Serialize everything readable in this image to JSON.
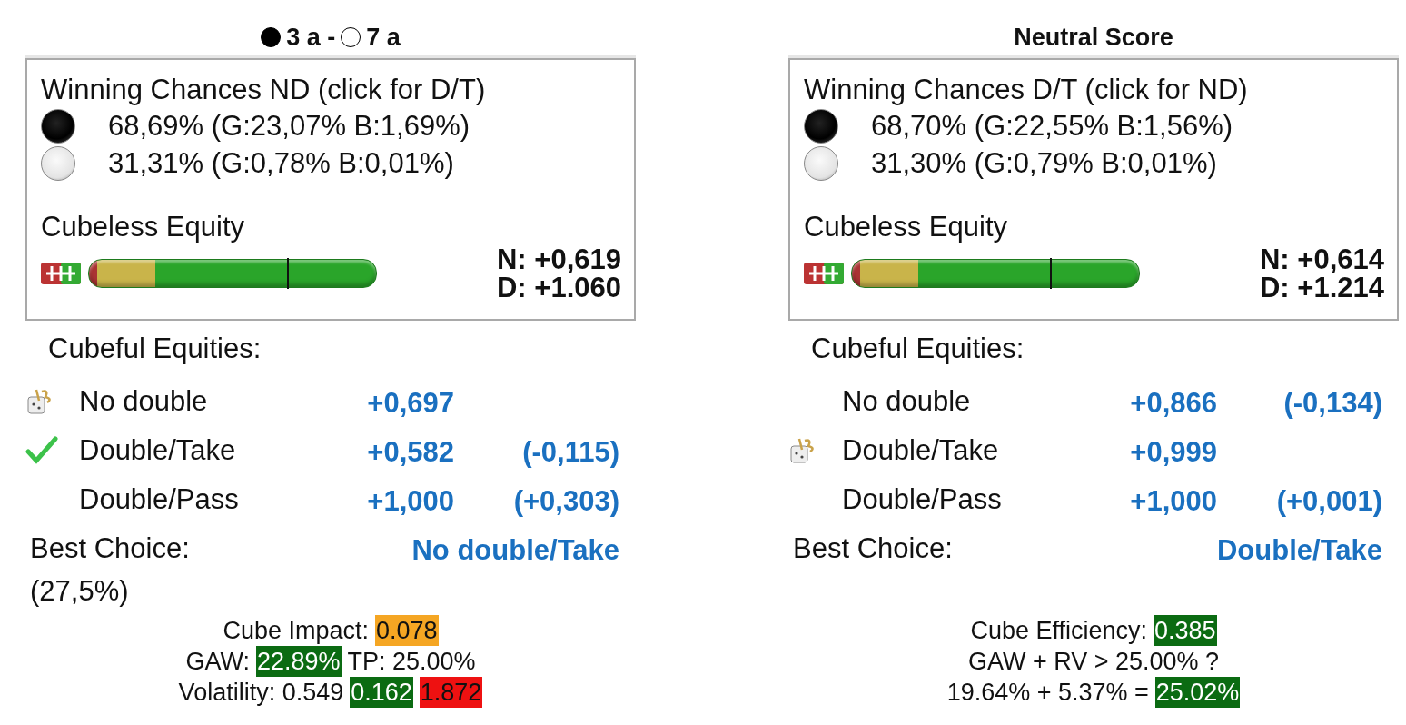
{
  "panels": [
    {
      "header": [
        {
          "kind": "disc",
          "filled": true
        },
        {
          "kind": "text",
          "text": "3 a -"
        },
        {
          "kind": "disc",
          "filled": false
        },
        {
          "kind": "text",
          "text": "7 a"
        }
      ],
      "winning": {
        "title": "Winning Chances ND (click for D/T)",
        "players": [
          {
            "dark": true,
            "text": "68,69% (G:23,07% B:1,69%)"
          },
          {
            "dark": false,
            "text": "31,31% (G:0,78% B:0,01%)"
          }
        ],
        "equity_label": "Cubeless Equity",
        "equity_bar": {
          "level": 0.69
        },
        "readings": [
          "N: +0,619",
          "D: +1.060"
        ]
      },
      "cubeful": {
        "title": "Cubeful Equities:",
        "rows": [
          {
            "played": true,
            "checked": false,
            "label": "No double",
            "equity": "+0,697"
          },
          {
            "played": false,
            "checked": true,
            "label": "Double/Take",
            "equity": "+0,582",
            "diff": "(-0,115)"
          },
          {
            "played": false,
            "checked": false,
            "label": "Double/Pass",
            "equity": "+1,000",
            "diff": "(+0,303)"
          }
        ],
        "best_label": "Best Choice:",
        "best_value": "No double/Take",
        "best_note": "(27,5%)"
      },
      "stats": [
        [
          {
            "text": "Cube Impact:"
          },
          {
            "text": "0.078",
            "color": "#f5a623"
          }
        ],
        [
          {
            "text": "GAW:"
          },
          {
            "text": "22.89%",
            "color": "#0b6b12"
          },
          {
            "text": "TP: 25.00%"
          }
        ],
        [
          {
            "text": "Volatility: 0.549"
          },
          {
            "text": "0.162",
            "color": "#0b6b12"
          },
          {
            "text": "1.872",
            "color": "#ee1111"
          }
        ]
      ]
    },
    {
      "header": [
        {
          "kind": "text",
          "text": "Neutral Score"
        }
      ],
      "winning": {
        "title": "Winning Chances D/T (click for ND)",
        "players": [
          {
            "dark": true,
            "text": "68,70% (G:22,55% B:1,56%)"
          },
          {
            "dark": false,
            "text": "31,30% (G:0,79% B:0,01%)"
          }
        ],
        "equity_label": "Cubeless Equity",
        "equity_bar": {
          "level": 0.69
        },
        "readings": [
          "N: +0,614",
          "D: +1.214"
        ]
      },
      "cubeful": {
        "title": "Cubeful Equities:",
        "rows": [
          {
            "played": false,
            "checked": false,
            "label": "No double",
            "equity": "+0,866",
            "diff": "(-0,134)"
          },
          {
            "played": true,
            "checked": false,
            "label": "Double/Take",
            "equity": "+0,999"
          },
          {
            "played": false,
            "checked": false,
            "label": "Double/Pass",
            "equity": "+1,000",
            "diff": "(+0,001)"
          }
        ],
        "best_label": "Best Choice:",
        "best_value": "Double/Take"
      },
      "stats": [
        [
          {
            "text": "Cube Efficiency:"
          },
          {
            "text": "0.385",
            "color": "#0b6b12"
          }
        ],
        [
          {
            "text": "GAW + RV > 25.00% ?"
          }
        ],
        [
          {
            "text": "19.64% + 5.37% ="
          },
          {
            "text": "25.02%",
            "color": "#0b6b12"
          }
        ]
      ]
    }
  ]
}
